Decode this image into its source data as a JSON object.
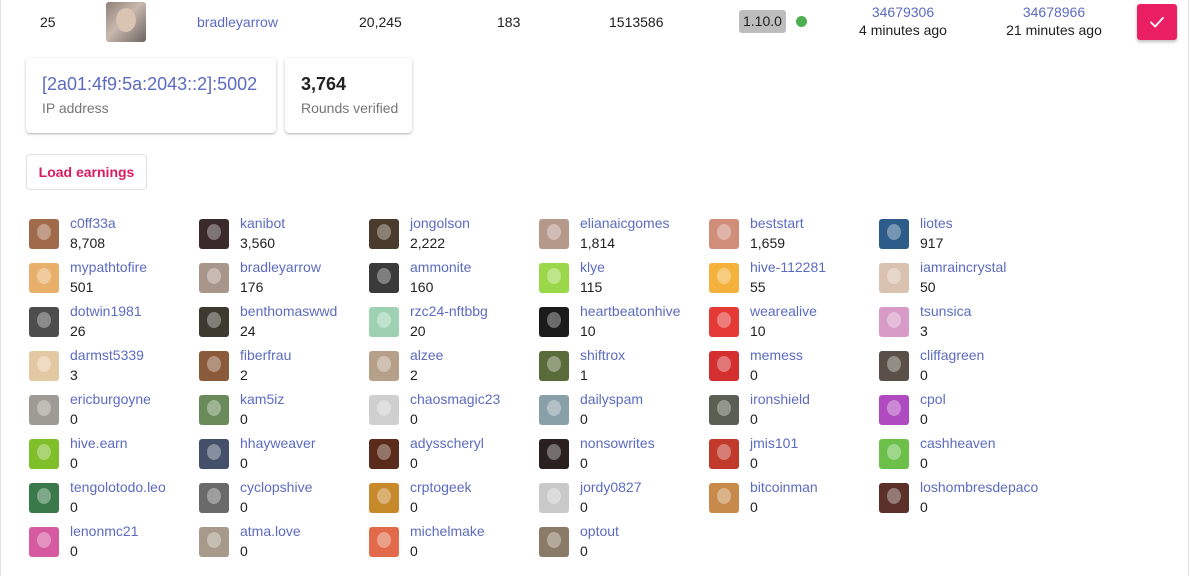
{
  "row": {
    "rank": "25",
    "username": "bradleyarrow",
    "value1": "20,245",
    "value2": "183",
    "value3": "1513586",
    "version": "1.10.0",
    "block1": "34679306",
    "block1_ago": "4 minutes ago",
    "block2": "34678966",
    "block2_ago": "21 minutes ago"
  },
  "cards": {
    "ip_value": "[2a01:4f9:5a:2043::2]:5002",
    "ip_label": "IP address",
    "rounds_value": "3,764",
    "rounds_label": "Rounds verified"
  },
  "load_button_label": "Load earnings",
  "colors": {
    "accent": "#e91e63",
    "link": "#5c6bc0",
    "status": "#4caf50"
  },
  "users": [
    {
      "name": "c0ff33a",
      "count": "8,708",
      "color": "#a16a4a"
    },
    {
      "name": "kanibot",
      "count": "3,560",
      "color": "#3b2a2a"
    },
    {
      "name": "jongolson",
      "count": "2,222",
      "color": "#4a3b2c"
    },
    {
      "name": "elianaicgomes",
      "count": "1,814",
      "color": "#b59a8c"
    },
    {
      "name": "beststart",
      "count": "1,659",
      "color": "#d08d7a"
    },
    {
      "name": "liotes",
      "count": "917",
      "color": "#2d5c8a"
    },
    {
      "name": "mypathtofire",
      "count": "501",
      "color": "#e8b06a"
    },
    {
      "name": "bradleyarrow",
      "count": "176",
      "color": "#a8968a"
    },
    {
      "name": "ammonite",
      "count": "160",
      "color": "#3a3a3a"
    },
    {
      "name": "klye",
      "count": "115",
      "color": "#9ad84a"
    },
    {
      "name": "hive-112281",
      "count": "55",
      "color": "#f4b23c"
    },
    {
      "name": "iamraincrystal",
      "count": "50",
      "color": "#d9c2b0"
    },
    {
      "name": "dotwin1981",
      "count": "26",
      "color": "#4d4d4d"
    },
    {
      "name": "benthomaswwd",
      "count": "24",
      "color": "#3e3a30"
    },
    {
      "name": "rzc24-nftbbg",
      "count": "20",
      "color": "#9ed1b2"
    },
    {
      "name": "heartbeatonhive",
      "count": "10",
      "color": "#1b1b1b"
    },
    {
      "name": "wearealive",
      "count": "10",
      "color": "#e53935"
    },
    {
      "name": "tsunsica",
      "count": "3",
      "color": "#d89bc7"
    },
    {
      "name": "darmst5339",
      "count": "3",
      "color": "#e3c9a3"
    },
    {
      "name": "fiberfrau",
      "count": "2",
      "color": "#8a5a3a"
    },
    {
      "name": "alzee",
      "count": "2",
      "color": "#b7a08a"
    },
    {
      "name": "shiftrox",
      "count": "1",
      "color": "#5a6b3a"
    },
    {
      "name": "memess",
      "count": "0",
      "color": "#d32f2f"
    },
    {
      "name": "cliffagreen",
      "count": "0",
      "color": "#5a5048"
    },
    {
      "name": "ericburgoyne",
      "count": "0",
      "color": "#9e9a94"
    },
    {
      "name": "kam5iz",
      "count": "0",
      "color": "#6a8a5a"
    },
    {
      "name": "chaosmagic23",
      "count": "0",
      "color": "#cfcfcf"
    },
    {
      "name": "dailyspam",
      "count": "0",
      "color": "#8aa0a8"
    },
    {
      "name": "ironshield",
      "count": "0",
      "color": "#5b5e52"
    },
    {
      "name": "cpol",
      "count": "0",
      "color": "#b04ac0"
    },
    {
      "name": "hive.earn",
      "count": "0",
      "color": "#7fbf2a"
    },
    {
      "name": "hhayweaver",
      "count": "0",
      "color": "#44506a"
    },
    {
      "name": "adysscheryl",
      "count": "0",
      "color": "#5a2a1a"
    },
    {
      "name": "nonsowrites",
      "count": "0",
      "color": "#2a2020"
    },
    {
      "name": "jmis101",
      "count": "0",
      "color": "#c0392b"
    },
    {
      "name": "cashheaven",
      "count": "0",
      "color": "#6cc04a"
    },
    {
      "name": "tengolotodo.leo",
      "count": "0",
      "color": "#3a7a4a"
    },
    {
      "name": "cyclopshive",
      "count": "0",
      "color": "#6a6a6a"
    },
    {
      "name": "crptogeek",
      "count": "0",
      "color": "#c8892a"
    },
    {
      "name": "jordy0827",
      "count": "0",
      "color": "#c9c9c9"
    },
    {
      "name": "bitcoinman",
      "count": "0",
      "color": "#c88a4a"
    },
    {
      "name": "loshombresdepaco",
      "count": "0",
      "color": "#5a3028"
    },
    {
      "name": "lenonmc21",
      "count": "0",
      "color": "#d65aa0"
    },
    {
      "name": "atma.love",
      "count": "0",
      "color": "#a89a8a"
    },
    {
      "name": "michelmake",
      "count": "0",
      "color": "#e06a4a"
    },
    {
      "name": "optout",
      "count": "0",
      "color": "#8a7a68"
    }
  ]
}
